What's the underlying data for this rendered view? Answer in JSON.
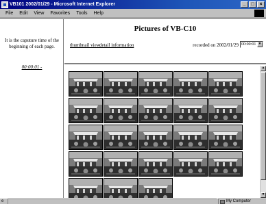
{
  "window": {
    "title": "VB101 2002/01/29 - Microsoft Internet Explorer",
    "buttons": {
      "minimize": "_",
      "maximize": "□",
      "close": "×"
    }
  },
  "menubar": {
    "items": [
      "File",
      "Edit",
      "View",
      "Favorites",
      "Tools",
      "Help"
    ]
  },
  "left_pane": {
    "caption": "It is the caputure time of the beginning of each page.",
    "time_link": "00:00:01 -"
  },
  "header": {
    "title": "Pictures of VB-C10",
    "links": {
      "thumbnail": "thumbnail view",
      "detail": "detail information"
    },
    "recorded_label": "recorded on 2002/01/29",
    "time_select": "00:00:01",
    "select_arrow": "▼"
  },
  "thumbnails": {
    "count": 23,
    "icon": "camera-snapshot"
  },
  "scrollbar": {
    "up": "▲",
    "down": "▼"
  },
  "statusbar": {
    "icon": "page-icon",
    "icon_glyph": "e",
    "zone": "My Computer"
  }
}
